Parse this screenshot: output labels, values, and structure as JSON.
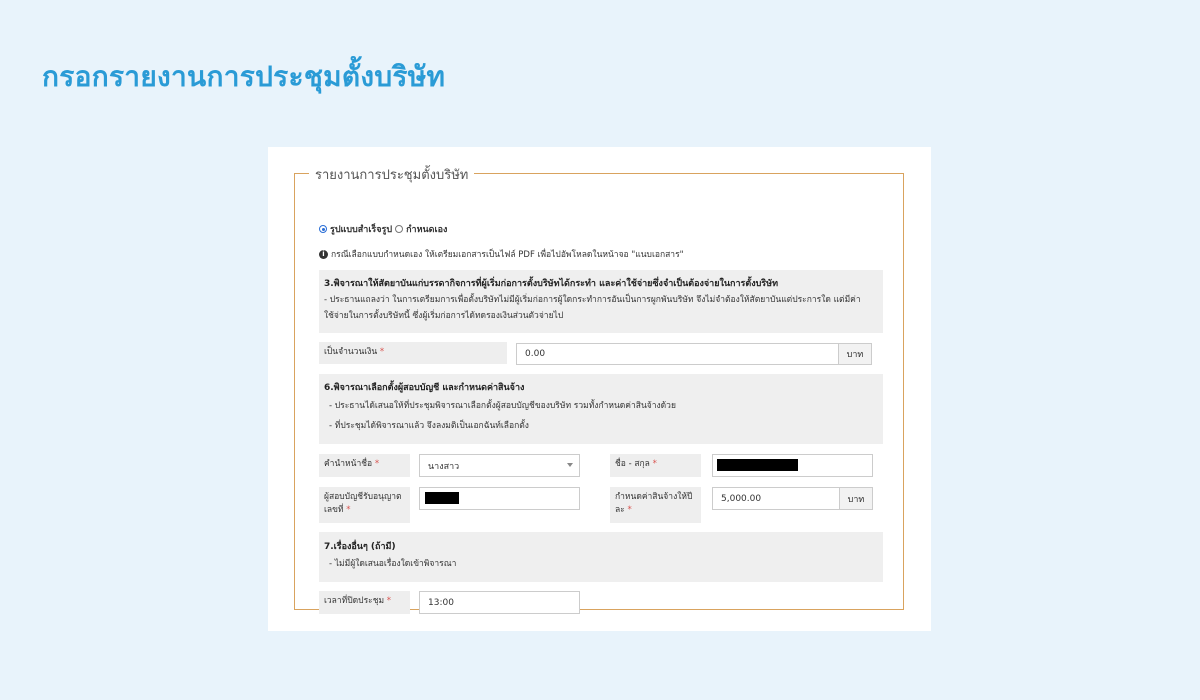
{
  "page_title": "กรอกรายงานการประชุมตั้งบริษัท",
  "form": {
    "legend": "รายงานการประชุมตั้งบริษัท",
    "radio_options": [
      {
        "label": "รูปแบบสำเร็จรูป",
        "checked": true
      },
      {
        "label": "กำหนดเอง",
        "checked": false
      }
    ],
    "note": "กรณีเลือกแบบกำหนดเอง ให้เตรียมเอกสารเป็นไฟล์ PDF เพื่อไปอัพโหลดในหน้าจอ \"แนบเอกสาร\"",
    "section3": {
      "title": "3.พิจารณาให้สัตยาบันแก่บรรดากิจการที่ผู้เริ่มก่อการตั้งบริษัทได้กระทำ และค่าใช้จ่ายซึ่งจำเป็นต้องจ่ายในการตั้งบริษัท",
      "line1": "- ประธานแถลงว่า ในการเตรียมการเพื่อตั้งบริษัทไม่มีผู้เริ่มก่อการผู้ใดกระทำการอันเป็นการผูกพันบริษัท จึงไม่จำต้องให้สัตยาบันแต่ประการใด แต่มีค่า",
      "line2": "ใช้จ่ายในการตั้งบริษัทนี้ ซึ่งผู้เริ่มก่อการได้ทดรองเงินส่วนตัวจ่ายไป"
    },
    "amount": {
      "label": "เป็นจำนวนเงิน",
      "value": "0.00",
      "unit": "บาท"
    },
    "section6": {
      "title": "6.พิจารณาเลือกตั้งผู้สอบบัญชี และกำหนดค่าสินจ้าง",
      "line1": "- ประธานได้เสนอให้ที่ประชุมพิจารณาเลือกตั้งผู้สอบบัญชีของบริษัท รวมทั้งกำหนดค่าสินจ้างด้วย",
      "line2": "- ที่ประชุมได้พิจารณาแล้ว จึงลงมติเป็นเอกฉันท์เลือกตั้ง"
    },
    "prefix": {
      "label": "คำนำหน้าชื่อ",
      "value": "นางสาว"
    },
    "fullname": {
      "label": "ชื่อ - สกุล"
    },
    "auditor_license": {
      "label_line1": "ผู้สอบบัญชีรับอนุญาต",
      "label_line2": "เลขที่"
    },
    "fee": {
      "label_line1": "กำหนดค่าสินจ้างให้ปี",
      "label_line2": "ละ",
      "value": "5,000.00",
      "unit": "บาท"
    },
    "section7": {
      "title": "7.เรื่องอื่นๆ (ถ้ามี)",
      "line1": "- ไม่มีผู้ใดเสนอเรื่องใดเข้าพิจารณา"
    },
    "close_time": {
      "label": "เวลาที่ปิดประชุม",
      "value": "13:00"
    },
    "required_mark": "*"
  }
}
